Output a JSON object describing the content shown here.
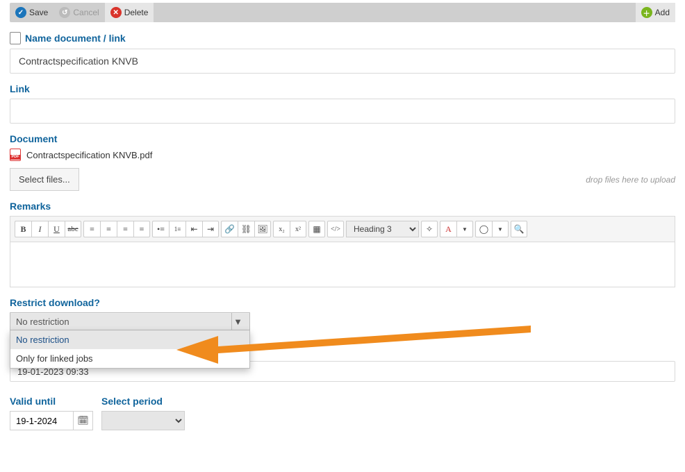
{
  "toolbar": {
    "save_label": "Save",
    "cancel_label": "Cancel",
    "delete_label": "Delete",
    "add_label": "Add"
  },
  "name_section": {
    "title": "Name document / link",
    "value": "Contractspecification KNVB"
  },
  "link_section": {
    "title": "Link",
    "value": ""
  },
  "document_section": {
    "title": "Document",
    "filename": "Contractspecification KNVB.pdf",
    "select_files_label": "Select files...",
    "drop_hint": "drop files here to upload"
  },
  "remarks_section": {
    "title": "Remarks",
    "heading_dropdown": "Heading 3"
  },
  "restrict_section": {
    "title": "Restrict download?",
    "selected": "No restriction",
    "options": [
      "No restriction",
      "Only for linked jobs"
    ]
  },
  "timestamp_field": "19-01-2023 09:33",
  "valid_until": {
    "title": "Valid until",
    "value": "19-1-2024"
  },
  "period": {
    "title": "Select period",
    "value": ""
  }
}
